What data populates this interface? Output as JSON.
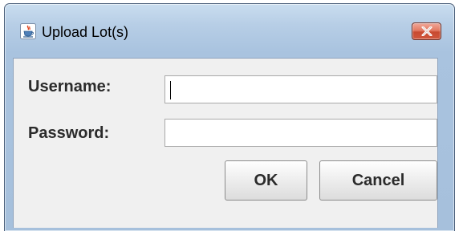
{
  "window": {
    "title": "Upload Lot(s)",
    "app_icon": "java-cup-icon",
    "close_icon": "close-icon",
    "colors": {
      "frame": "#b7cee6",
      "client_background": "#f0f0f0",
      "close_button": "#d0573d"
    }
  },
  "form": {
    "username_label": "Username:",
    "username_value": "",
    "password_label": "Password:",
    "password_value": ""
  },
  "buttons": {
    "ok_label": "OK",
    "cancel_label": "Cancel"
  }
}
